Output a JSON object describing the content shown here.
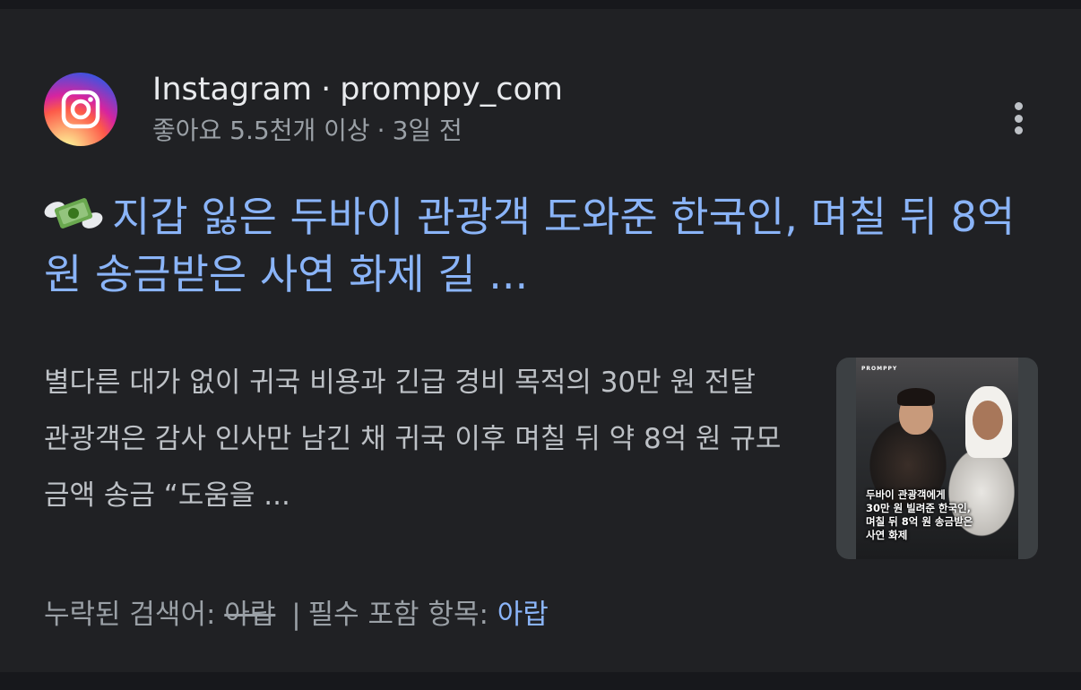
{
  "result": {
    "source": "Instagram",
    "site": "promppy_com",
    "separator": "·",
    "likes": "좋아요 5.5천개 이상",
    "age": "3일 전",
    "title": "지갑 잃은 두바이 관광객 도와준 한국인, 며칠 뒤 8억 원 송금받은 사연 화제 길 ...",
    "snippet": "별다른 대가 없이 귀국 비용과 긴급 경비 목적의 30만 원 전달 관광객은 감사 인사만 남긴 채 귀국 이후 며칠 뒤 약 8억 원 규모 금액 송금 “도움을 ...",
    "thumbnail": {
      "brand": "PROMPPY",
      "caption": "두바이 관광객에게\n30만 원 빌려준 한국인,\n며칠 뒤 8억 원 송금받은\n사연 화제"
    },
    "missing": {
      "label": "누락된 검색어:",
      "struck_term": "아랍",
      "divider": "|",
      "must_include_label": "필수 포함 항목:",
      "must_include_term": "아랍"
    }
  },
  "icons": {
    "logo": "instagram-logo",
    "more": "more-vert-icon",
    "title_emoji": "money-with-wings-emoji"
  },
  "colors": {
    "background": "#202124",
    "link": "#8ab4f8",
    "text": "#bdc1c6",
    "muted": "#9aa0a6"
  }
}
